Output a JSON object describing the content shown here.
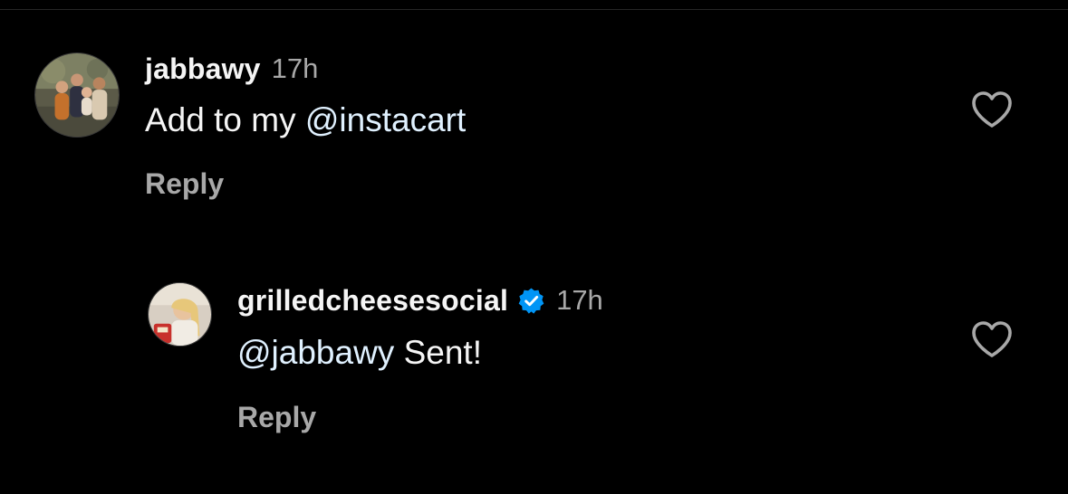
{
  "comments": [
    {
      "username": "jabbawy",
      "timestamp": "17h",
      "verified": false,
      "mention": "@instacart",
      "text_before": "Add to my ",
      "text_after": "",
      "reply_label": "Reply",
      "like_icon": "heart-outline-icon"
    },
    {
      "username": "grilledcheesesocial",
      "timestamp": "17h",
      "verified": true,
      "mention": "@jabbawy",
      "text_before": "",
      "text_after": " Sent!",
      "reply_label": "Reply",
      "like_icon": "heart-outline-icon"
    }
  ],
  "colors": {
    "background": "#000000",
    "text_primary": "#f5f5f5",
    "text_secondary": "#a8a8a8",
    "mention": "#e0f1ff",
    "verified_badge": "#0095f6"
  }
}
